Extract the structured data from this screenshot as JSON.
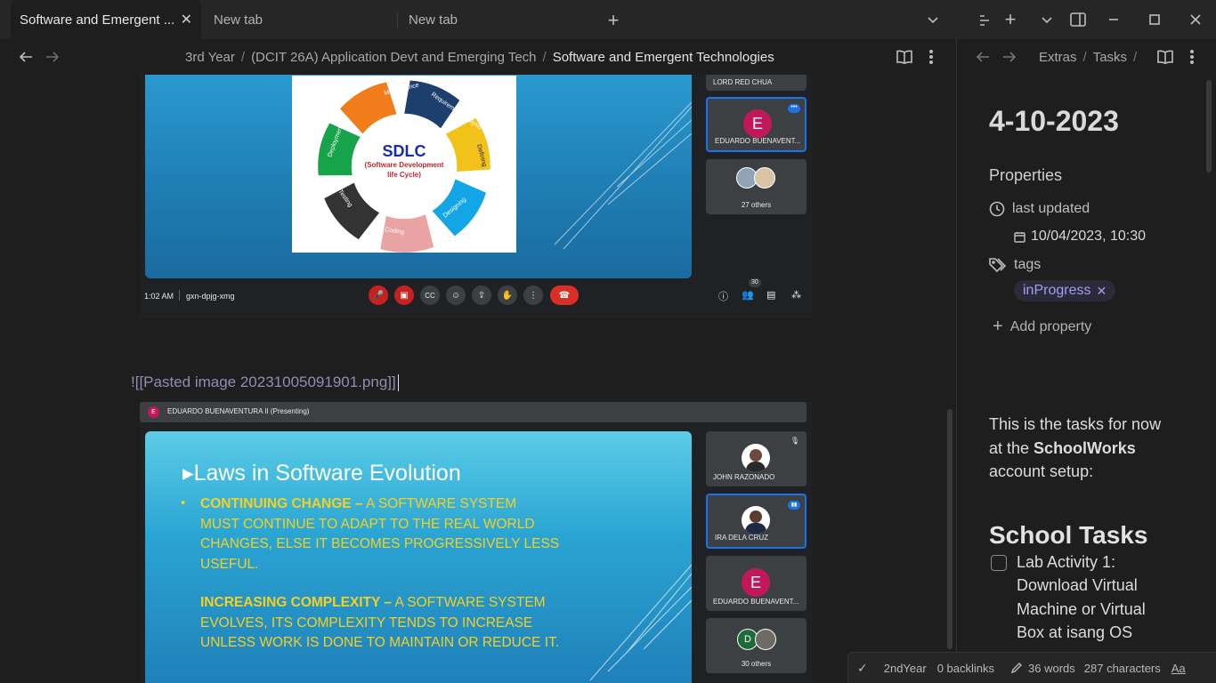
{
  "tabs": [
    {
      "label": "Software and Emergent ..."
    },
    {
      "label": "New tab"
    },
    {
      "label": "New tab"
    }
  ],
  "breadcrumb": {
    "items": [
      "3rd Year",
      "(DCIT 26A) Application Devt and Emerging Tech",
      "Software and Emergent Technologies"
    ],
    "sep": "/"
  },
  "right_breadcrumb": {
    "items": [
      "Extras",
      "Tasks"
    ],
    "sep": "/"
  },
  "meet1": {
    "tiles": [
      {
        "name": "LORD RED CHUA"
      },
      {
        "name": "EDUARDO BUENAVENT...",
        "initial": "E"
      },
      {
        "name": "27 others"
      }
    ],
    "time": "1:02 AM",
    "code": "gxn-dpjg-xmg",
    "participants_badge": "30",
    "slide": {
      "title": "SDLC",
      "subtitle": "(Software Development life Cycle)",
      "segments": [
        "Maintenance",
        "Requirement Analysis",
        "Defining",
        "Designing",
        "Coding",
        "Testing",
        "Deployment"
      ]
    }
  },
  "embed_text": "![[Pasted image 20231005091901.png]]",
  "meet2": {
    "presenter_initial": "E",
    "presenter": "EDUARDO BUENAVENTURA II (Presenting)",
    "tiles": [
      {
        "name": "JOHN RAZONADO"
      },
      {
        "name": "IRA DELA CRUZ"
      },
      {
        "name": "EDUARDO BUENAVENT...",
        "initial": "E"
      },
      {
        "name": "30 others",
        "initial": "D"
      }
    ],
    "slide": {
      "title": "Laws in Software Evolution",
      "bullet1_bold": "CONTINUING CHANGE –",
      "bullet1_lines": [
        "A SOFTWARE SYSTEM",
        "MUST CONTINUE TO ADAPT TO THE REAL WORLD",
        "CHANGES, ELSE IT BECOMES PROGRESSIVELY LESS",
        "USEFUL."
      ],
      "bullet2_bold": "INCREASING COMPLEXITY –",
      "bullet2_lines": [
        "A SOFTWARE SYSTEM",
        "EVOLVES, ITS COMPLEXITY TENDS TO INCREASE",
        "UNLESS WORK IS DONE TO MAINTAIN OR REDUCE IT."
      ]
    }
  },
  "note": {
    "title": "4-10-2023",
    "properties_label": "Properties",
    "last_updated_label": "last updated",
    "last_updated_value": "10/04/2023, 10:30",
    "tags_label": "tags",
    "tag": "inProgress",
    "add_property": "Add property",
    "intro_1": "This is the tasks for now",
    "intro_2a": "at the ",
    "intro_2b": "SchoolWorks",
    "intro_3": "account setup:",
    "heading": "School Tasks",
    "task_lines": [
      "Lab Activity 1:",
      "Download Virtual",
      "Machine or Virtual",
      "Box at isang OS"
    ]
  },
  "status": {
    "folder": "2ndYear",
    "backlinks": "0 backlinks",
    "words": "36 words",
    "characters": "287 characters",
    "font": "Aa"
  }
}
